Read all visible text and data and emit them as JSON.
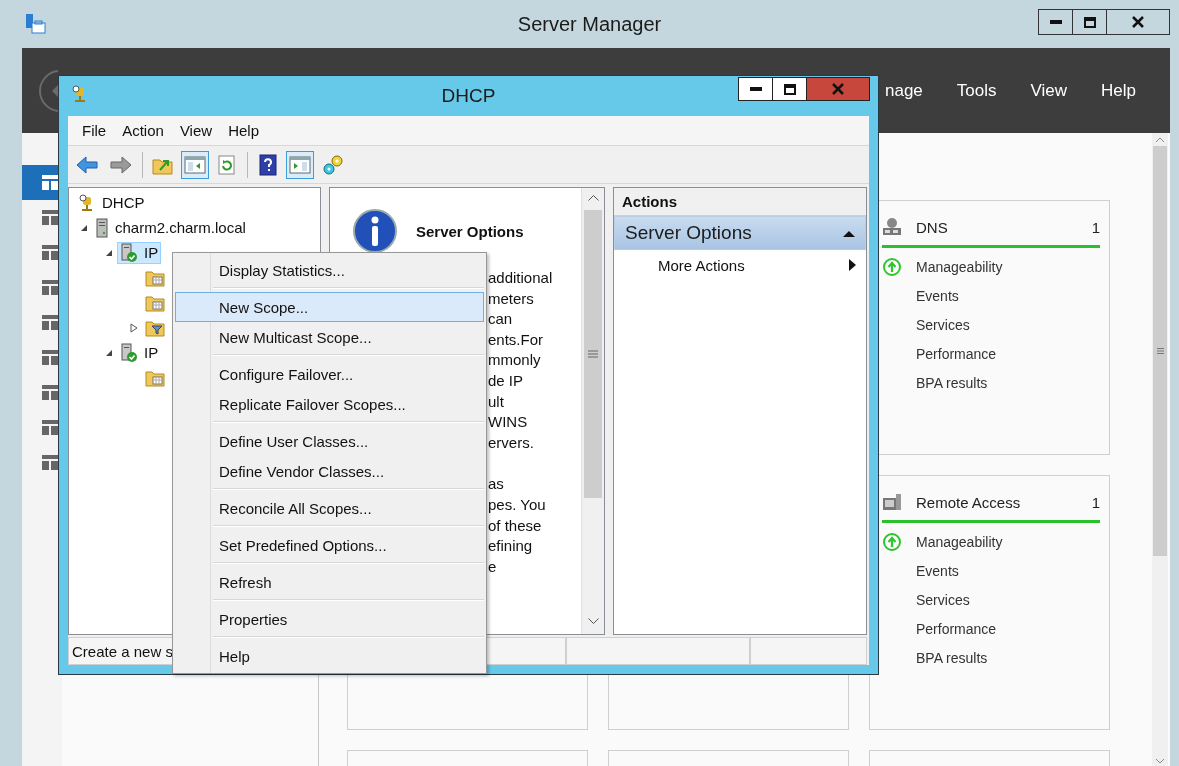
{
  "server_manager": {
    "title": "Server Manager",
    "menu": [
      "nage",
      "Tools",
      "View",
      "Help"
    ],
    "sidebar": [
      {
        "selected": true
      },
      {
        "selected": false
      },
      {
        "selected": false
      },
      {
        "selected": false
      },
      {
        "selected": false
      },
      {
        "selected": false
      },
      {
        "selected": false
      },
      {
        "selected": false
      },
      {
        "selected": false
      }
    ],
    "tiles": [
      {
        "title": "DNS",
        "count": "1",
        "rows": [
          {
            "label": "Manageability",
            "kind": "status"
          },
          {
            "label": "Events",
            "kind": "plain"
          },
          {
            "label": "Services",
            "kind": "plain"
          },
          {
            "label": "Performance",
            "kind": "plain"
          },
          {
            "label": "BPA results",
            "kind": "plain"
          }
        ]
      },
      {
        "title": "Remote Access",
        "count": "1",
        "rows": [
          {
            "label": "Manageability",
            "kind": "status"
          },
          {
            "label": "Events",
            "kind": "plain"
          },
          {
            "label": "Services",
            "kind": "plain"
          },
          {
            "label": "Performance",
            "kind": "plain"
          },
          {
            "label": "BPA results",
            "kind": "plain"
          }
        ]
      }
    ]
  },
  "dhcp": {
    "title": "DHCP",
    "menu": [
      "File",
      "Action",
      "View",
      "Help"
    ],
    "toolbar": [
      {
        "kind": "back"
      },
      {
        "kind": "forward"
      },
      {
        "kind": "separator"
      },
      {
        "kind": "up"
      },
      {
        "kind": "console-tree",
        "pressed": true
      },
      {
        "kind": "refresh"
      },
      {
        "kind": "separator"
      },
      {
        "kind": "help"
      },
      {
        "kind": "action-pane",
        "pressed": true
      },
      {
        "kind": "plugin"
      }
    ],
    "tree": [
      {
        "label": "DHCP",
        "kind": "root",
        "selected": false,
        "children": [
          {
            "label": "charm2.charm.local",
            "kind": "server",
            "selected": false,
            "expanded": true,
            "children": [
              {
                "label": "IP",
                "kind": "ipv4",
                "selected": true,
                "expanded": true,
                "children": [
                  {
                    "kind": "folder",
                    "selected": false
                  },
                  {
                    "kind": "folder",
                    "selected": false
                  },
                  {
                    "kind": "filter",
                    "selected": false,
                    "expanded": false
                  }
                ]
              },
              {
                "label": "IP",
                "kind": "ipv4",
                "selected": false,
                "expanded": true,
                "children": [
                  {
                    "kind": "folder",
                    "selected": false
                  }
                ]
              }
            ]
          }
        ]
      }
    ],
    "details": {
      "title": "Server Options",
      "paragraphs": [
        [
          "additional",
          "meters",
          "can",
          "ents.For",
          "mmonly",
          "de IP",
          "ult",
          "WINS",
          "ervers."
        ],
        [
          "as",
          "pes.  You",
          "of these",
          "efining",
          "e"
        ]
      ]
    },
    "actions": {
      "header": "Actions",
      "groups": [
        {
          "title": "Server Options",
          "expanded": true,
          "items": [
            {
              "label": "More Actions"
            }
          ]
        }
      ]
    },
    "status_bar": {
      "text": "Create a new s"
    }
  },
  "context_menu": {
    "groups": [
      [
        {
          "label": "Display Statistics...",
          "selected": false
        }
      ],
      [
        {
          "label": "New Scope...",
          "selected": true
        },
        {
          "label": "New Multicast Scope...",
          "selected": false
        }
      ],
      [
        {
          "label": "Configure Failover...",
          "selected": false
        },
        {
          "label": "Replicate Failover Scopes...",
          "selected": false
        }
      ],
      [
        {
          "label": "Define User Classes...",
          "selected": false
        },
        {
          "label": "Define Vendor Classes...",
          "selected": false
        }
      ],
      [
        {
          "label": "Reconcile All Scopes...",
          "selected": false
        }
      ],
      [
        {
          "label": "Set Predefined Options...",
          "selected": false
        }
      ],
      [
        {
          "label": "Refresh",
          "selected": false
        }
      ],
      [
        {
          "label": "Properties",
          "selected": false
        }
      ],
      [
        {
          "label": "Help",
          "selected": false
        }
      ]
    ]
  }
}
